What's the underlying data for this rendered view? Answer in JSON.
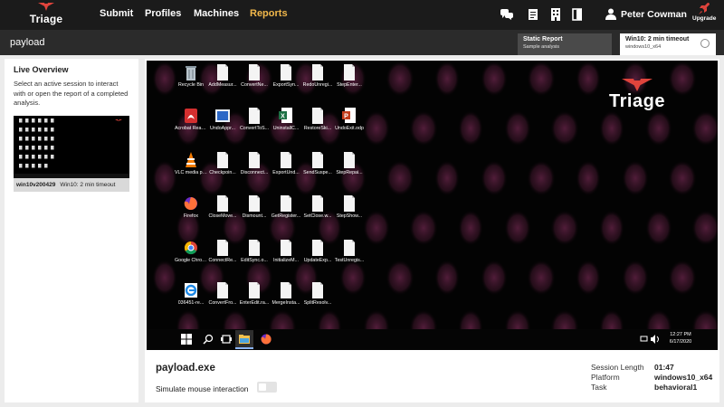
{
  "nav": {
    "logo_text": "Triage",
    "links": [
      "Submit",
      "Profiles",
      "Machines",
      "Reports"
    ],
    "active_link": "Reports",
    "icons": [
      "chat-icon",
      "document-icon",
      "building-icon",
      "door-icon",
      "user-icon",
      "rocket-icon"
    ],
    "username": "Peter Cowman",
    "upgrade_label": "Upgrade",
    "accent_color": "#f2b84b",
    "brand_color": "#e0443c"
  },
  "subbar": {
    "title": "payload",
    "tabs": [
      {
        "title": "Static Report",
        "subtitle": "Sample analysis"
      },
      {
        "title": "Win10: 2 min timeout",
        "subtitle": "windows10_x64"
      }
    ]
  },
  "sidebar": {
    "title": "Live Overview",
    "description": "Select an active session to interact with or open the report of a completed analysis.",
    "session": {
      "id": "win10v200429",
      "timeout": "Win10: 2 min timeout"
    }
  },
  "desktop": {
    "icons": [
      "Recycle Bin",
      "AddMeasur...",
      "ConvertNe...",
      "ExportSyn...",
      "RedoUnregi...",
      "StepEnter...",
      "Acrobat Reader DC",
      "UndoAppr...",
      "ConvertToS...",
      "UninstallC...",
      "RestoreSki...",
      "UndoExit.odp",
      "VLC media player",
      "Checkpoin...",
      "Disconnect...",
      "ExportUnd...",
      "SendSuspe...",
      "StepRepai...",
      "Firefox",
      "CloseMove...",
      "Dismount...",
      "GetRegister...",
      "SetClose.w...",
      "StepShow...",
      "Google Chrome",
      "ConnectRe...",
      "EditSync.o...",
      "InitializeM...",
      "UpdateExp...",
      "TestUnregis...",
      "036451-re...",
      "ConvertFro...",
      "EnterEdit.ra...",
      "MergeInsta...",
      "SplitResolv..."
    ],
    "watermark": "Triage",
    "clock_time": "12:27 PM",
    "clock_date": "6/17/2020"
  },
  "details": {
    "filename": "payload.exe",
    "simulate_label": "Simulate mouse interaction",
    "simulate_enabled": false,
    "session_length_label": "Session Length",
    "session_length": "01:47",
    "platform_label": "Platform",
    "platform": "windows10_x64",
    "task_label": "Task",
    "task": "behavioral1"
  }
}
